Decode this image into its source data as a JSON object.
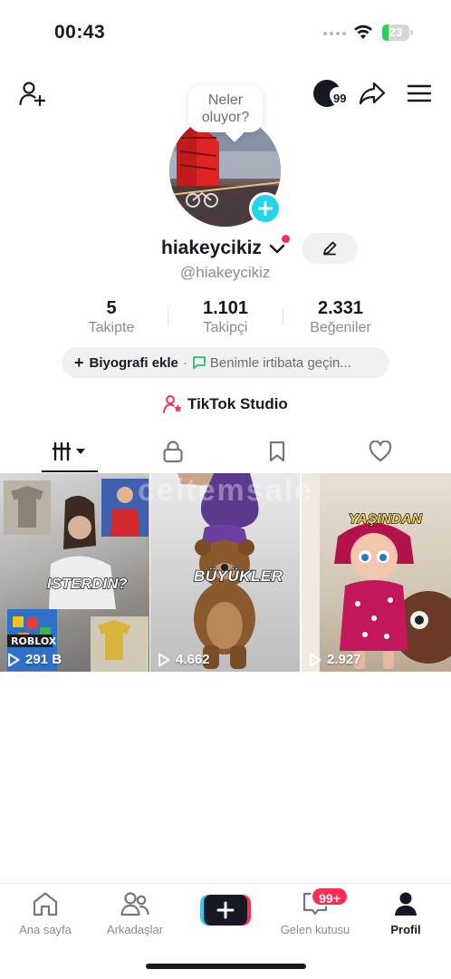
{
  "status_bar": {
    "time": "00:43",
    "battery": "23"
  },
  "top_nav": {
    "story_count": "99"
  },
  "profile": {
    "bubble_line1": "Neler",
    "bubble_line2": "oluyor?",
    "username": "hiakeycikiz",
    "handle": "@hiakeycikiz"
  },
  "stats": {
    "following": {
      "value": "5",
      "label": "Takipte"
    },
    "followers": {
      "value": "1.101",
      "label": "Takipçi"
    },
    "likes": {
      "value": "2.331",
      "label": "Beğeniler"
    }
  },
  "bio": {
    "plus": "+",
    "add_label": "Biyografi ekle",
    "separator": "·",
    "contact_label": "Benimle irtibata geçin..."
  },
  "studio": {
    "label": "TikTok Studio"
  },
  "videos": [
    {
      "caption": "ISTERDIN?",
      "views": "291 B"
    },
    {
      "caption": "BÜYÜKLER",
      "views": "4.662"
    },
    {
      "caption": "YAŞINDAN",
      "views": "2.927"
    }
  ],
  "watermark": "ceitemsale",
  "bottom_nav": {
    "home": "Ana sayfa",
    "friends": "Arkadaşlar",
    "inbox": "Gelen kutusu",
    "inbox_badge": "99+",
    "profile": "Profil"
  },
  "colors": {
    "accent_red": "#fe2c55",
    "accent_cyan": "#20d5ec",
    "battery_green": "#34c759",
    "text_dark": "#161823",
    "text_muted": "#8a8b91"
  }
}
